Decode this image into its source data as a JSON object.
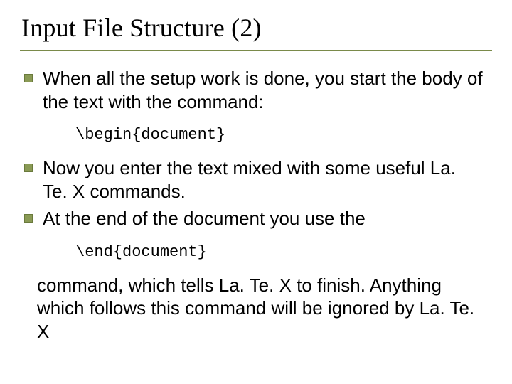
{
  "title": "Input File Structure (2)",
  "bullets": [
    {
      "text": "When all the setup work is done, you start the body of the text with the command:"
    },
    {
      "text": "Now you enter the text mixed with some useful La. Te. X commands."
    },
    {
      "text": "At the end of the document you use the"
    }
  ],
  "code": {
    "begin": "\\begin{document}",
    "end": "\\end{document}"
  },
  "tail": "command, which tells La. Te. X to finish. Anything which follows this command will be ignored by La. Te. X"
}
